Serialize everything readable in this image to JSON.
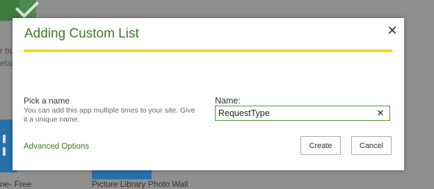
{
  "background": {
    "left_snippet_1": "r bu",
    "left_snippet_2": "etail",
    "left_caption": "ne- Free",
    "mid_caption": "Picture Library Photo Wall"
  },
  "dialog": {
    "title": "Adding Custom List",
    "close_icon": "close-icon",
    "progress_fraction": 1.0,
    "progress_color": "#f4d91a",
    "pick_name_label": "Pick a name",
    "pick_name_help": "You can add this app multiple times to your site. Give it a unique name.",
    "name_label": "Name:",
    "name_value": "RequestType",
    "clear_icon": "clear-icon",
    "advanced_options": "Advanced Options",
    "create_label": "Create",
    "cancel_label": "Cancel",
    "accent_color": "#3b7a24"
  }
}
